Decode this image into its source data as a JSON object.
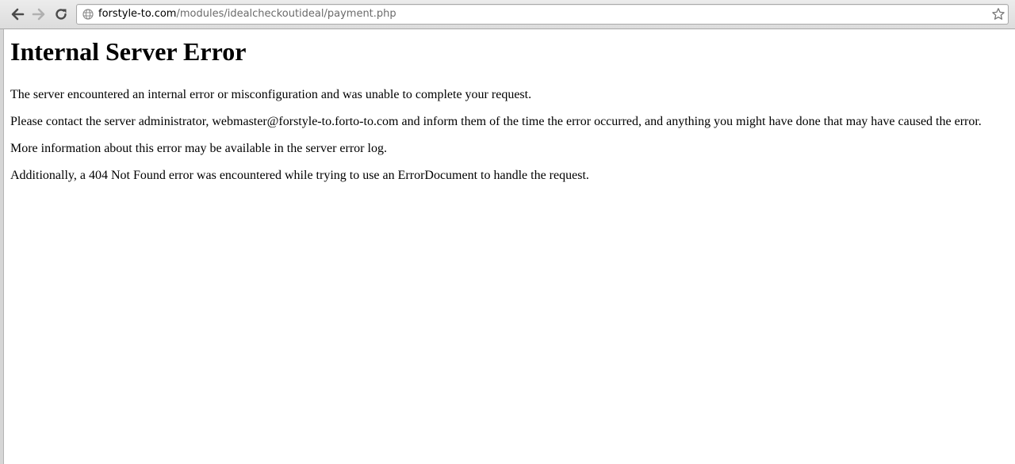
{
  "browser": {
    "url_host": "forstyle-to.com",
    "url_path": "/modules/idealcheckoutideal/payment.php",
    "icons": {
      "back": "arrow-left-icon",
      "forward": "arrow-right-icon",
      "reload": "reload-icon",
      "site": "globe-icon",
      "bookmark": "star-icon"
    }
  },
  "page": {
    "heading": "Internal Server Error",
    "paragraphs": [
      "The server encountered an internal error or misconfiguration and was unable to complete your request.",
      "Please contact the server administrator, webmaster@forstyle-to.forto-to.com and inform them of the time the error occurred, and anything you might have done that may have caused the error.",
      "More information about this error may be available in the server error log.",
      "Additionally, a 404 Not Found error was encountered while trying to use an ErrorDocument to handle the request."
    ]
  }
}
